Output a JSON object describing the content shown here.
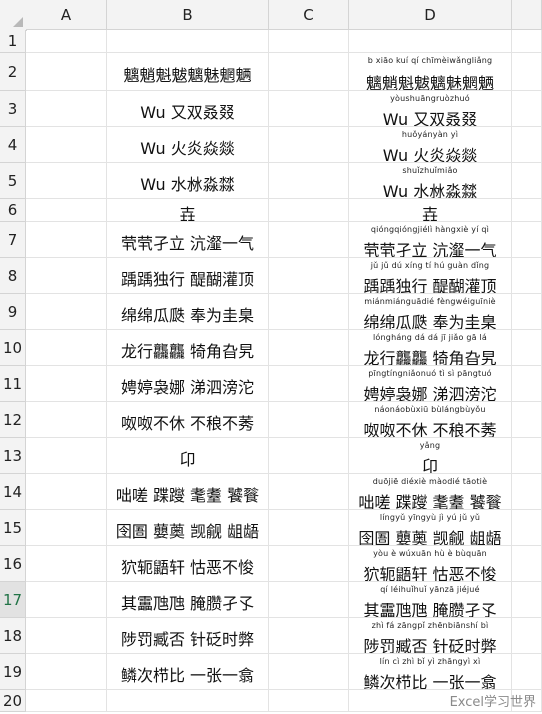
{
  "columns": [
    "A",
    "B",
    "C",
    "D"
  ],
  "rows": [
    {
      "n": "1",
      "b": "",
      "d": "",
      "py": ""
    },
    {
      "n": "2",
      "b": "魑魈魁魃魑魅魍魉",
      "d": "魑魈魁魃魑魅魍魉",
      "py": "b xiāo kuí qí chīmèiwǎngliǎng"
    },
    {
      "n": "3",
      "b": "Wu 又双叒叕",
      "d": "Wu 又双叒叕",
      "py": "yòushuāngruòzhuó"
    },
    {
      "n": "4",
      "b": "Wu 火炎焱燚",
      "d": "Wu 火炎焱燚",
      "py": "huǒyányàn yì"
    },
    {
      "n": "5",
      "b": "Wu 水沝淼㵘",
      "d": "Wu 水沝淼㵘",
      "py": "shuǐzhuǐmiǎo"
    },
    {
      "n": "6",
      "b": "壵",
      "d": "壵",
      "py": ""
    },
    {
      "n": "7",
      "b": "茕茕孑立 沆瀣一气",
      "d": "茕茕孑立 沆瀣一气",
      "py": "qióngqióngjiélì hàngxiè yí qì"
    },
    {
      "n": "8",
      "b": "踽踽独行 醍醐灌顶",
      "d": "踽踽独行 醍醐灌顶",
      "py": "jǔ jǔ dú xíng tí hú guàn dǐng"
    },
    {
      "n": "9",
      "b": "绵绵瓜瓞 奉为圭臬",
      "d": "绵绵瓜瓞 奉为圭臬",
      "py": "miánmiánguādié fèngwéiguīniè"
    },
    {
      "n": "10",
      "b": "龙行龘龘 犄角旮旯",
      "d": "龙行龘龘 犄角旮旯",
      "py": "lóngháng dá dá jī jiǎo gā lá"
    },
    {
      "n": "11",
      "b": "娉婷袅娜 涕泗滂沱",
      "d": "娉婷袅娜 涕泗滂沱",
      "py": "pīngtíngniǎonuó tì sì pāngtuó"
    },
    {
      "n": "12",
      "b": "呶呶不休 不稂不莠",
      "d": "呶呶不休 不稂不莠",
      "py": "náonáobùxiū bùlángbùyǒu"
    },
    {
      "n": "13",
      "b": "卬",
      "d": "卬",
      "py": "yǎng"
    },
    {
      "n": "14",
      "b": "咄嗟 蹀躞 耄耋 饕餮",
      "d": "咄嗟 蹀躞 耄耋 饕餮",
      "py": "duōjiē diéxiè màodié tāotiè"
    },
    {
      "n": "15",
      "b": "囹圄 蘡薁 觊觎 龃龉",
      "d": "囹圄 蘡薁 觊觎 龃龉",
      "py": "língyǔ yīngyù jì yú jǔ yǔ"
    },
    {
      "n": "16",
      "b": "狖轭鼯轩 怙恶不悛",
      "d": "狖轭鼯轩 怙恶不悛",
      "py": "yòu è wúxuān hù è bùquān"
    },
    {
      "n": "17",
      "b": "其靁虺虺 腌臜孑孓",
      "d": "其靁虺虺 腌臜孑孓",
      "py": "qí léihuǐhuǐ yānzā jiéjué"
    },
    {
      "n": "18",
      "b": "陟罚臧否 针砭时弊",
      "d": "陟罚臧否 针砭时弊",
      "py": "zhì fá zāngpǐ zhēnbiānshí bì"
    },
    {
      "n": "19",
      "b": "鳞次栉比 一张一翕",
      "d": "鳞次栉比 一张一翕",
      "py": "lín cì zhì bǐ yì zhāngyì xì"
    },
    {
      "n": "20",
      "b": "",
      "d": "",
      "py": ""
    }
  ],
  "watermark": "Excel学习世界"
}
